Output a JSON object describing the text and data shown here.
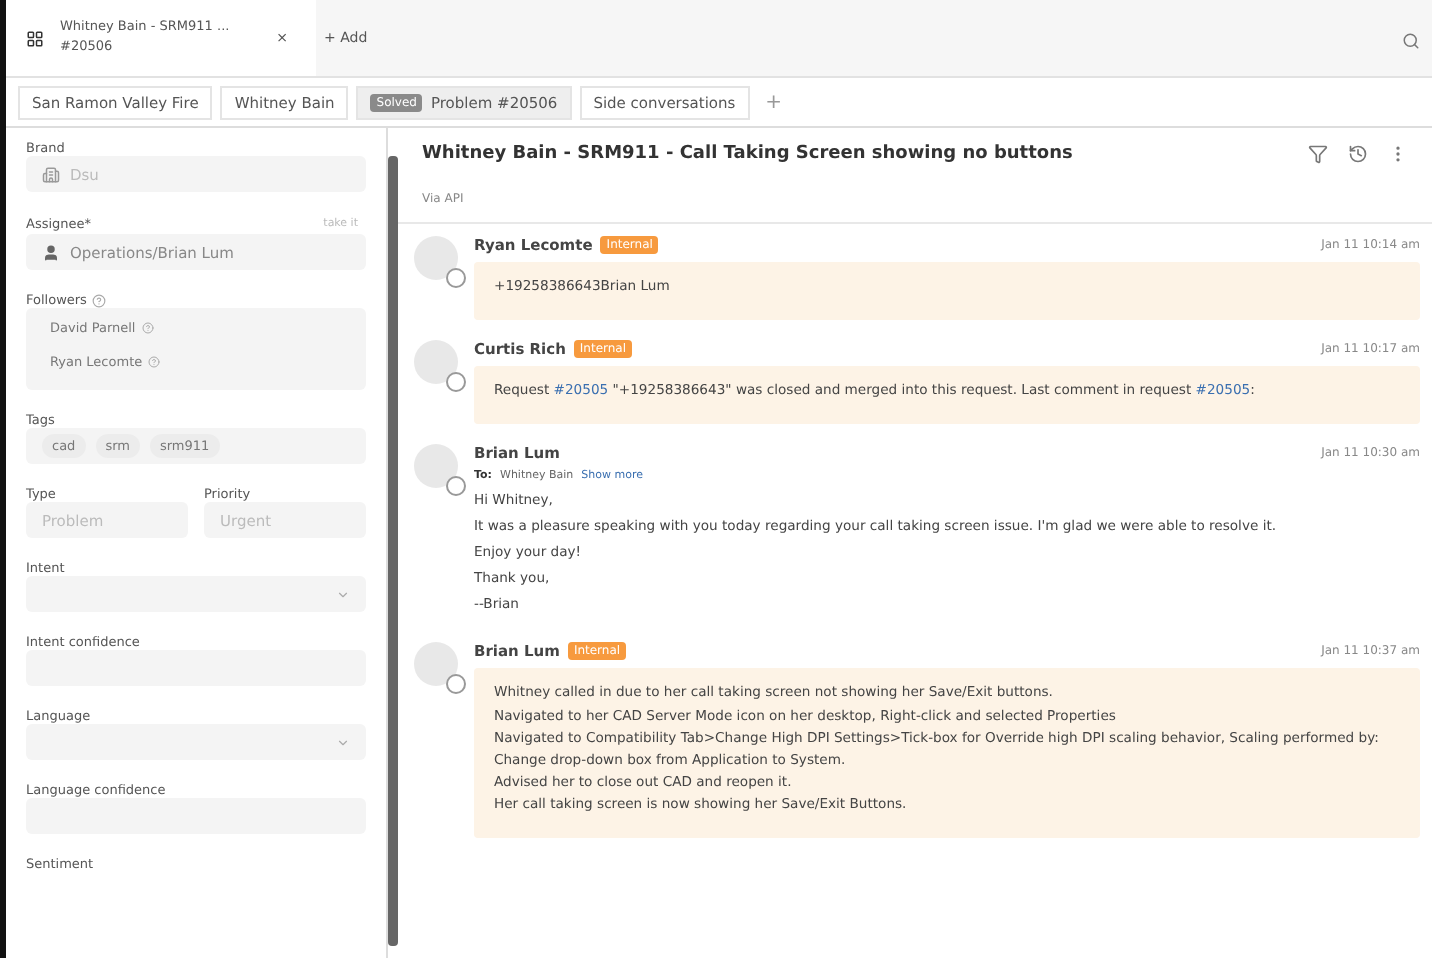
{
  "window_tab": {
    "title": "Whitney Bain - SRM911 ...",
    "subtitle": "#20506",
    "close": "×",
    "add": "+ Add"
  },
  "breadcrumbs": [
    {
      "kind": "crumb",
      "label": "San Ramon Valley Fire"
    },
    {
      "kind": "crumb",
      "label": "Whitney Bain"
    },
    {
      "kind": "ticket",
      "badge": "Solved",
      "label": "Problem #20506"
    },
    {
      "kind": "crumb",
      "label": "Side conversations"
    },
    {
      "kind": "add",
      "label": "+"
    }
  ],
  "sidebar": {
    "fields": [
      {
        "kind": "brand",
        "label": "Brand",
        "value": "Dsu"
      },
      {
        "kind": "assignee",
        "label": "Assignee*",
        "action": "take it",
        "value": "Operations/Brian Lum"
      },
      {
        "kind": "followers",
        "label": "Followers",
        "items": [
          "David Parnell",
          "Ryan Lecomte"
        ]
      },
      {
        "kind": "tags",
        "label": "Tags",
        "items": [
          "cad",
          "srm",
          "srm911"
        ]
      },
      {
        "kind": "pair",
        "items": [
          {
            "label": "Type",
            "value": "Problem"
          },
          {
            "label": "Priority",
            "value": "Urgent"
          }
        ]
      },
      {
        "kind": "dropdown",
        "label": "Intent"
      },
      {
        "kind": "empty",
        "label": "Intent confidence"
      },
      {
        "kind": "dropdown",
        "label": "Language"
      },
      {
        "kind": "empty",
        "label": "Language confidence"
      },
      {
        "kind": "heading",
        "label": "Sentiment"
      }
    ]
  },
  "conversation": {
    "title": "Whitney Bain - SRM911 - Call Taking Screen showing no buttons",
    "via": "Via API",
    "messages": [
      {
        "kind": "internal",
        "author": "Ryan Lecomte",
        "badge": "Internal",
        "time": "Jan 11 10:14 am",
        "lines": [
          [
            {
              "text": "+19258386643Brian Lum",
              "link": false
            }
          ]
        ]
      },
      {
        "kind": "internal",
        "author": "Curtis Rich",
        "badge": "Internal",
        "time": "Jan 11 10:17 am",
        "lines": [
          [
            {
              "text": "Request ",
              "link": false
            },
            {
              "text": "#20505",
              "link": true
            },
            {
              "text": " \"+19258386643\" was closed and merged into this request. Last comment in request ",
              "link": false
            },
            {
              "text": "#20505",
              "link": true
            },
            {
              "text": ":",
              "link": false
            }
          ]
        ]
      },
      {
        "kind": "email",
        "author": "Brian Lum",
        "to_label": "To:",
        "to": "Whitney Bain",
        "more": "Show more",
        "time": "Jan 11 10:30 am",
        "paragraphs": [
          "Hi Whitney,",
          "It was a pleasure speaking with you today regarding your call taking screen issue. I'm glad we were able to resolve it.",
          "Enjoy your day!",
          "Thank you,",
          "--Brian"
        ]
      },
      {
        "kind": "internal",
        "author": "Brian Lum",
        "badge": "Internal",
        "time": "Jan 11 10:37 am",
        "lines": [
          [
            {
              "text": "Whitney called in due to her call taking screen not showing her Save/Exit buttons.",
              "link": false
            }
          ],
          [
            {
              "text": "Navigated to her CAD Server Mode icon on her desktop, Right-click and selected Properties",
              "link": false
            }
          ],
          [
            {
              "text": "Navigated to Compatibility Tab>Change High DPI Settings>Tick-box for Override high DPI scaling behavior, Scaling performed by:",
              "link": false
            }
          ],
          [
            {
              "text": "Change drop-down box from Application to System.",
              "link": false
            }
          ],
          [
            {
              "text": "Advised her to close out CAD and reopen it.",
              "link": false
            }
          ],
          [
            {
              "text": "Her call taking screen is now showing her Save/Exit Buttons.",
              "link": false
            }
          ]
        ]
      }
    ]
  }
}
